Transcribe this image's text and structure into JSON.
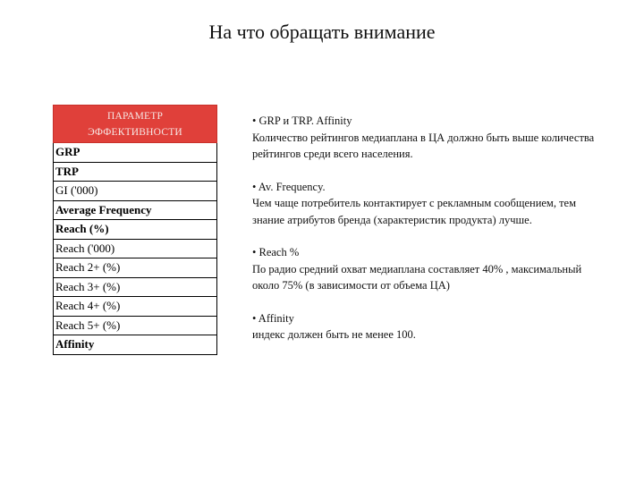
{
  "slide": {
    "title": "На что обращать внимание"
  },
  "table": {
    "header_line1": "ПАРАМЕТР",
    "header_line2": "ЭФФЕКТИВНОСТИ",
    "header_color": "#e0403a",
    "rows": [
      {
        "label": "GRP",
        "bold": true
      },
      {
        "label": "TRP",
        "bold": true
      },
      {
        "label": "GI ('000)",
        "bold": false
      },
      {
        "label": "Average Frequency",
        "bold": true
      },
      {
        "label": "Reach (%)",
        "bold": true
      },
      {
        "label": "Reach ('000)",
        "bold": false
      },
      {
        "label": "Reach 2+ (%)",
        "bold": false
      },
      {
        "label": "Reach 3+ (%)",
        "bold": false
      },
      {
        "label": "Reach 4+ (%)",
        "bold": false
      },
      {
        "label": "Reach 5+ (%)",
        "bold": false
      },
      {
        "label": "Affinity",
        "bold": true
      }
    ]
  },
  "notes": [
    {
      "heading": "• GRP и TRP. Affinity",
      "body": "Количество рейтингов медиаплана в ЦА должно быть выше количества рейтингов среди всего населения."
    },
    {
      "heading": "• Av. Frequency.",
      "body": "Чем чаще потребитель контактирует с рекламным сообщением, тем знание атрибутов бренда (характеристик продукта) лучше."
    },
    {
      "heading": "• Reach %",
      "body": "По радио средний охват медиаплана составляет 40% , максимальный около 75% (в зависимости от объема ЦА)"
    },
    {
      "heading": "• Affinity",
      "body": "индекс должен быть не менее 100."
    }
  ]
}
